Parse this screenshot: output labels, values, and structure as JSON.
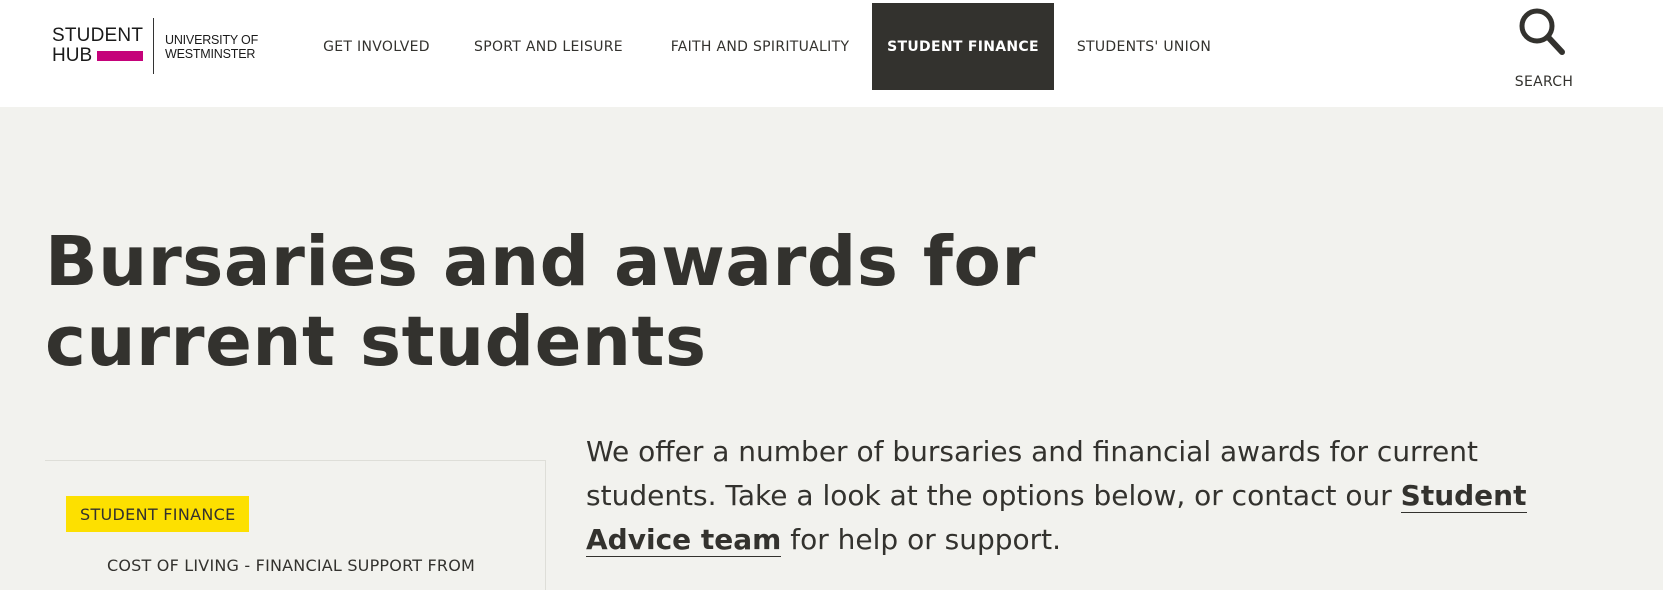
{
  "logo": {
    "line1": "STUDENT",
    "line2": "HUB",
    "university": "UNIVERSITY OF WESTMINSTER"
  },
  "nav": {
    "items": [
      {
        "label": "GET INVOLVED"
      },
      {
        "label": "SPORT AND LEISURE"
      },
      {
        "label": "FAITH AND SPIRITUALITY"
      },
      {
        "label": "STUDENT FINANCE",
        "active": true
      },
      {
        "label": "STUDENTS' UNION"
      }
    ]
  },
  "search": {
    "label": "SEARCH",
    "icon": "search-icon"
  },
  "page": {
    "title": "Bursaries and awards for current students"
  },
  "sidebar": {
    "badge": "STUDENT FINANCE",
    "link": "COST OF LIVING - FINANCIAL SUPPORT FROM"
  },
  "intro": {
    "text_before": "We offer a number of bursaries and financial awards for current students. Take a look at the options below, or contact our ",
    "link": "Student Advice team",
    "text_after": " for help or support."
  },
  "colors": {
    "brand_magenta": "#c5027a",
    "dark": "#33322e",
    "background": "#f2f2ee",
    "badge_yellow": "#fde000"
  }
}
